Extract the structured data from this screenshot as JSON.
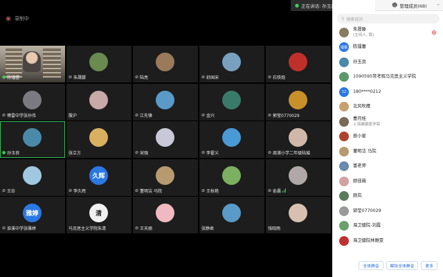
{
  "topbar": {
    "recording_label": "录制中",
    "speaking_text": "正在讲话: 孙玉良; 陈镭蕾;"
  },
  "panel": {
    "title": "管理成员(68)",
    "search_placeholder": "搜索成员",
    "members": [
      {
        "name": "朱晟滕",
        "sub": "(主持人, 我)",
        "avatar_text": "",
        "color": "#8a7b62"
      },
      {
        "name": "陈镭蕾",
        "sub": "",
        "avatar_text": "镭蕾",
        "color": "#2b78e4"
      },
      {
        "name": "孙玉良",
        "sub": "",
        "avatar_text": "",
        "color": "#4a8aa8"
      },
      {
        "name": "1590595常考辉马克思主义学院",
        "sub": "",
        "avatar_text": "",
        "color": "#5a9a6a"
      },
      {
        "name": "180****0212",
        "sub": "",
        "avatar_text": "12",
        "color": "#2b78e4"
      },
      {
        "name": "北风吹雁",
        "sub": "",
        "avatar_text": "",
        "color": "#c8a070"
      },
      {
        "name": "曹月桂",
        "sub": "上海健康医学院",
        "avatar_text": "",
        "color": "#7a6a55"
      },
      {
        "name": "辰小星",
        "sub": "",
        "avatar_text": "",
        "color": "#b04030"
      },
      {
        "name": "董明洁 马院",
        "sub": "",
        "avatar_text": "",
        "color": "#b89a70"
      },
      {
        "name": "富老师",
        "sub": "",
        "avatar_text": "",
        "color": "#6a8ab0"
      },
      {
        "name": "顾佳薇",
        "sub": "",
        "avatar_text": "",
        "color": "#d4a0a0"
      },
      {
        "name": "顾岚",
        "sub": "",
        "avatar_text": "",
        "color": "#5a7a5a"
      },
      {
        "name": "郭莹0770029",
        "sub": "",
        "avatar_text": "",
        "color": "#9a9a9a"
      },
      {
        "name": "海卫健院-刘霞",
        "sub": "",
        "avatar_text": "",
        "color": "#6aa06a"
      },
      {
        "name": "海卫健院林雅雯",
        "sub": "",
        "avatar_text": "",
        "color": "#c03030"
      }
    ],
    "buttons": {
      "mute_all": "全体静音",
      "unmute_all": "解除全体静音",
      "more": "更多"
    }
  },
  "tiles": [
    {
      "name": "陈镭蕾",
      "mic": "on",
      "video": true,
      "color": "",
      "avatar_text": ""
    },
    {
      "name": "朱晟滕",
      "mic": "off",
      "video": false,
      "color": "#6a8a50",
      "avatar_text": ""
    },
    {
      "name": "陆亮",
      "mic": "off",
      "video": false,
      "color": "#9a7a5a",
      "avatar_text": ""
    },
    {
      "name": "舒国宋",
      "mic": "off",
      "video": false,
      "color": "#7aa0c0",
      "avatar_text": ""
    },
    {
      "name": "石铁炮",
      "mic": "off",
      "video": false,
      "color": "#c0302a",
      "avatar_text": ""
    },
    {
      "name": "傅雷中学张孙伟",
      "mic": "off",
      "video": false,
      "color": "#7a7a80",
      "avatar_text": ""
    },
    {
      "name": "殷沪",
      "mic": "none",
      "video": false,
      "color": "#c8a8a8",
      "avatar_text": ""
    },
    {
      "name": "江先锋",
      "mic": "off",
      "video": false,
      "color": "#5a9ac8",
      "avatar_text": ""
    },
    {
      "name": "金兴",
      "mic": "off",
      "video": false,
      "color": "#3a7a6a",
      "avatar_text": ""
    },
    {
      "name": "郭莹0770029",
      "mic": "off",
      "video": false,
      "color": "#c8902a",
      "avatar_text": ""
    },
    {
      "name": "孙玉良",
      "mic": "on",
      "video": false,
      "color": "#4a8aa8",
      "avatar_text": "",
      "active": true
    },
    {
      "name": "张立方",
      "mic": "none",
      "video": false,
      "color": "#d8b060",
      "avatar_text": ""
    },
    {
      "name": "宋强",
      "mic": "off",
      "video": false,
      "color": "#c8c8d8",
      "avatar_text": ""
    },
    {
      "name": "李翟义",
      "mic": "off",
      "video": false,
      "color": "#4a9ad8",
      "avatar_text": ""
    },
    {
      "name": "周浦小学二年级陆璀",
      "mic": "off",
      "video": false,
      "color": "#d0b8a8",
      "avatar_text": ""
    },
    {
      "name": "王珍",
      "mic": "off",
      "video": false,
      "color": "#a0c8e0",
      "avatar_text": ""
    },
    {
      "name": "李久辉",
      "mic": "off",
      "video": false,
      "color": "#2b78e4",
      "avatar_text": "久辉"
    },
    {
      "name": "董明洁 马院",
      "mic": "off",
      "video": false,
      "color": "#b89a70",
      "avatar_text": ""
    },
    {
      "name": "王秋艳",
      "mic": "off",
      "video": false,
      "color": "#7ab060",
      "avatar_text": ""
    },
    {
      "name": "俞晨",
      "mic": "off",
      "video": false,
      "color": "#b0a8a8",
      "avatar_text": "",
      "bars": true
    },
    {
      "name": "淮溪中学张雅婷",
      "mic": "off",
      "video": false,
      "color": "#2b78e4",
      "avatar_text": "雅婷"
    },
    {
      "name": "马克思主义学院朱清",
      "mic": "none",
      "video": false,
      "color": "#f0f0f0",
      "avatar_text": "清",
      "dark_text": true
    },
    {
      "name": "王天丽",
      "mic": "off",
      "video": false,
      "color": "#f0b8c0",
      "avatar_text": ""
    },
    {
      "name": "张静君",
      "mic": "none",
      "video": false,
      "color": "#5a9ac8",
      "avatar_text": ""
    },
    {
      "name": "钱晓雨",
      "mic": "none",
      "video": false,
      "color": "#d8c0b0",
      "avatar_text": ""
    }
  ]
}
